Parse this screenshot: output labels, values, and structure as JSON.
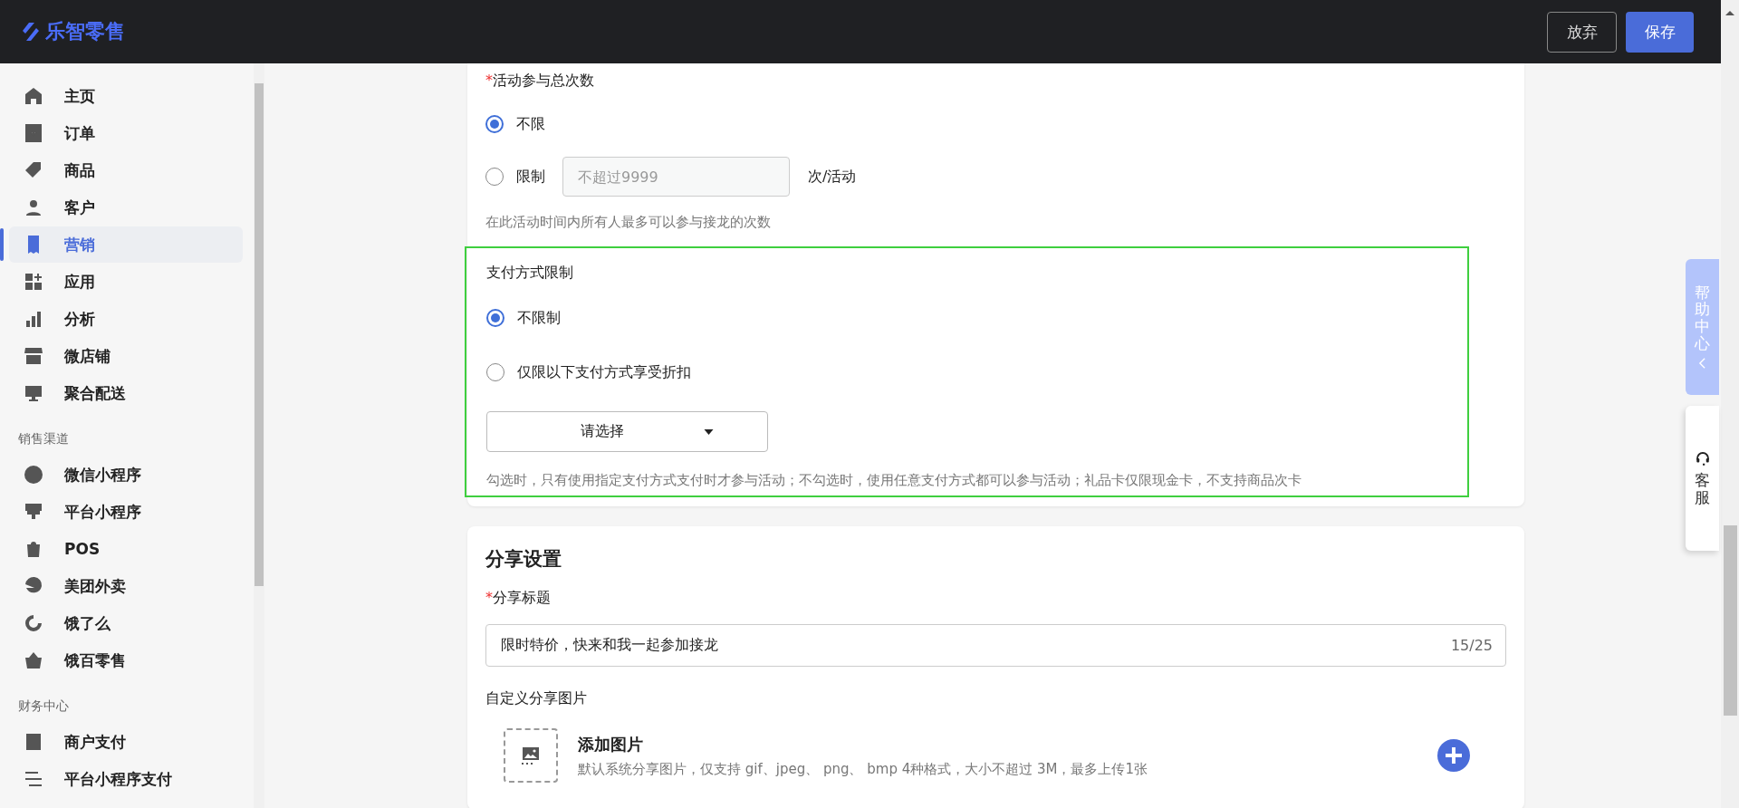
{
  "app": {
    "logo": "乐智零售"
  },
  "header_buttons": [
    {
      "label": "放弃",
      "kind": "secondary"
    },
    {
      "label": "保存",
      "kind": "primary"
    }
  ],
  "sidebar": {
    "groups": [
      {
        "items": [
          {
            "label": "主页",
            "selected": false
          },
          {
            "label": "订单",
            "selected": false
          },
          {
            "label": "商品",
            "selected": false
          },
          {
            "label": "客户",
            "selected": false
          },
          {
            "label": "营销",
            "selected": true
          },
          {
            "label": "应用",
            "selected": false
          },
          {
            "label": "分析",
            "selected": false
          },
          {
            "label": "微店铺",
            "selected": false
          },
          {
            "label": "聚合配送",
            "selected": false
          }
        ]
      },
      {
        "heading": "销售渠道",
        "items": [
          {
            "label": "微信小程序",
            "selected": false
          },
          {
            "label": "平台小程序",
            "selected": false
          },
          {
            "label": "POS",
            "selected": false
          },
          {
            "label": "美团外卖",
            "selected": false
          },
          {
            "label": "饿了么",
            "selected": false
          },
          {
            "label": "饿百零售",
            "selected": false
          }
        ]
      },
      {
        "heading": "财务中心",
        "items": [
          {
            "label": "商户支付",
            "selected": false
          },
          {
            "label": "平台小程序支付",
            "selected": false
          }
        ]
      }
    ]
  },
  "participation": {
    "label": "活动参与总次数",
    "required_mark": "*",
    "options": [
      {
        "label": "不限",
        "selected": true
      },
      {
        "label": "限制",
        "selected": false,
        "placeholder": "不超过9999",
        "unit": "次/活动"
      }
    ],
    "hint": "在此活动时间内所有人最多可以参与接龙的次数"
  },
  "payment": {
    "label": "支付方式限制",
    "options": [
      {
        "label": "不限制",
        "selected": true
      },
      {
        "label": "仅限以下支付方式享受折扣",
        "selected": false
      }
    ],
    "select": {
      "placeholder": "请选择"
    },
    "hint": "勾选时，只有使用指定支付方式支付时才参与活动；不勾选时，使用任意支付方式都可以参与活动；礼品卡仅限现金卡，不支持商品次卡"
  },
  "share": {
    "title": "分享设置",
    "share_title": {
      "label": "分享标题",
      "required_mark": "*",
      "value": "限时特价，快来和我一起参加接龙",
      "counter": "15/25"
    },
    "image": {
      "label": "自定义分享图片",
      "title": "添加图片",
      "description": "默认系统分享图片，仅支持 gif、jpeg、 png、 bmp 4种格式，大小不超过 3M，最多上传1张"
    }
  },
  "help": {
    "help_center": "帮助中心",
    "service": "客服"
  }
}
